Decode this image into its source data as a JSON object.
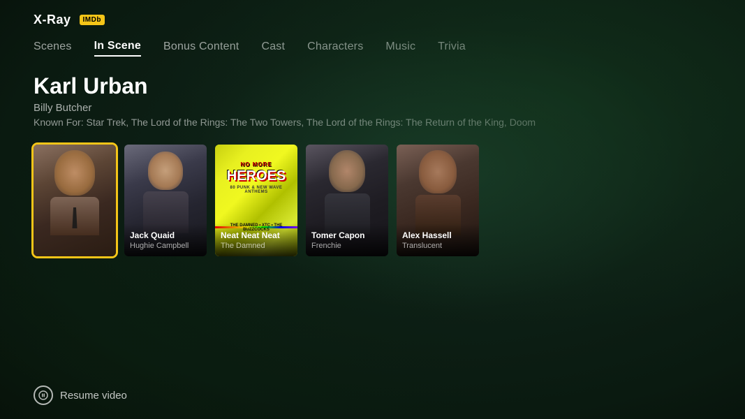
{
  "header": {
    "xray_label": "X-Ray",
    "imdb_label": "IMDb"
  },
  "nav": {
    "items": [
      {
        "id": "scenes",
        "label": "Scenes",
        "active": false
      },
      {
        "id": "in-scene",
        "label": "In Scene",
        "active": true
      },
      {
        "id": "bonus-content",
        "label": "Bonus Content",
        "active": false
      },
      {
        "id": "cast",
        "label": "Cast",
        "active": false
      },
      {
        "id": "characters",
        "label": "Characters",
        "active": false
      },
      {
        "id": "music",
        "label": "Music",
        "active": false
      },
      {
        "id": "trivia",
        "label": "Trivia",
        "active": false
      }
    ]
  },
  "selected_actor": {
    "name": "Karl Urban",
    "character": "Billy Butcher",
    "known_for": "Known For: Star Trek, The Lord of the Rings: The Two Towers, The Lord of the Rings: The Return of the King, Doom"
  },
  "cards": [
    {
      "id": "card-1",
      "actor": "Karl Urban",
      "character": "",
      "selected": true,
      "bg_class": "card-1-bg",
      "type": "photo"
    },
    {
      "id": "card-2",
      "actor": "Jack Quaid",
      "character": "Hughie Campbell",
      "selected": false,
      "bg_class": "card-2-bg",
      "type": "photo"
    },
    {
      "id": "card-3",
      "actor": "Neat Neat Neat",
      "character": "The Damned",
      "selected": false,
      "bg_class": "card-3-bg",
      "type": "album"
    },
    {
      "id": "card-4",
      "actor": "Tomer Capon",
      "character": "Frenchie",
      "selected": false,
      "bg_class": "card-4-bg",
      "type": "photo"
    },
    {
      "id": "card-5",
      "actor": "Alex Hassell",
      "character": "Translucent",
      "selected": false,
      "bg_class": "card-5-bg",
      "type": "photo"
    }
  ],
  "bottom": {
    "resume_label": "Resume video"
  }
}
